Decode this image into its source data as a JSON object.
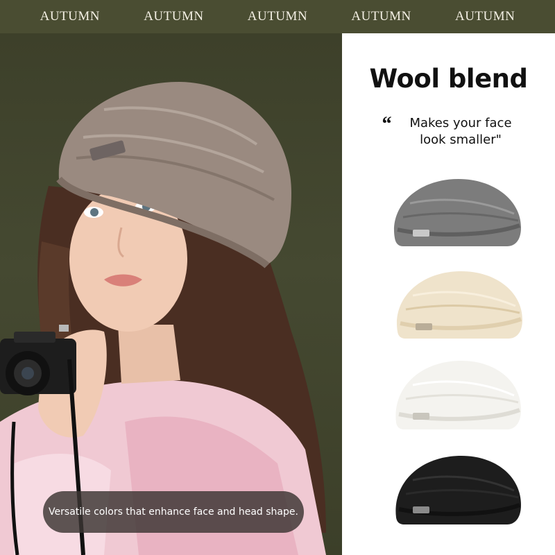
{
  "banner": {
    "words": [
      "AUTUMN",
      "AUTUMN",
      "AUTUMN",
      "AUTUMN",
      "AUTUMN"
    ]
  },
  "product": {
    "headline": "Wool blend",
    "quote_mark": "“",
    "tagline": "Makes your face\nlook smaller\"",
    "caption": "Versatile colors that enhance face and head shape."
  },
  "colors": {
    "banner_bg": "#4a4d32",
    "photo_bg": "#454931",
    "hat_taupe": "#9a8a80",
    "variants": [
      {
        "name": "gray-beret",
        "hex": "#7c7c7c"
      },
      {
        "name": "cream-beret",
        "hex": "#efe3cb"
      },
      {
        "name": "white-beret",
        "hex": "#f4f3ef"
      },
      {
        "name": "black-beret",
        "hex": "#1d1d1d"
      }
    ]
  }
}
